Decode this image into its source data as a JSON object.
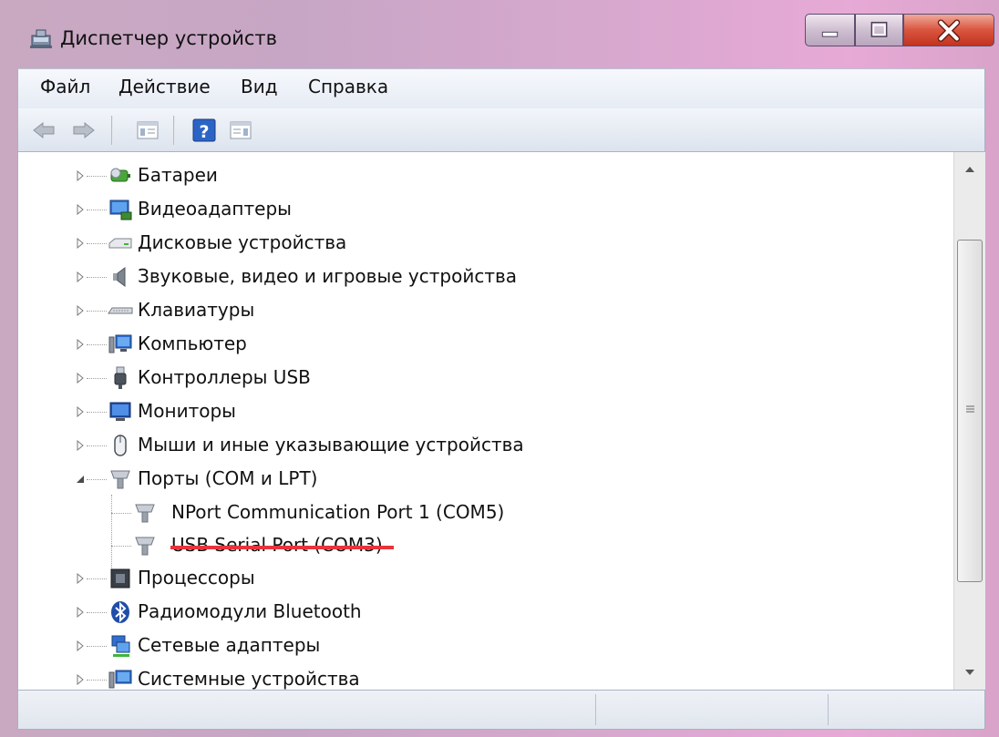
{
  "window": {
    "title": "Диспетчер устройств",
    "controls": {
      "minimize_icon": "minimize-icon",
      "maximize_icon": "maximize-icon",
      "close_icon": "close-icon"
    }
  },
  "menu": {
    "items": [
      "Файл",
      "Действие",
      "Вид",
      "Справка"
    ]
  },
  "toolbar": {
    "buttons": [
      "back-arrow-icon",
      "forward-arrow-icon",
      "properties-list-icon",
      "help-icon",
      "properties-panel-icon"
    ]
  },
  "tree": {
    "items": [
      {
        "label": "Батареи",
        "icon": "battery-icon",
        "expanded": false
      },
      {
        "label": "Видеоадаптеры",
        "icon": "display-adapter-icon",
        "expanded": false
      },
      {
        "label": "Дисковые устройства",
        "icon": "disk-drive-icon",
        "expanded": false
      },
      {
        "label": "Звуковые, видео и игровые устройства",
        "icon": "speaker-icon",
        "expanded": false
      },
      {
        "label": "Клавиатуры",
        "icon": "keyboard-icon",
        "expanded": false
      },
      {
        "label": "Компьютер",
        "icon": "computer-icon",
        "expanded": false
      },
      {
        "label": "Контроллеры USB",
        "icon": "usb-connector-icon",
        "expanded": false
      },
      {
        "label": "Мониторы",
        "icon": "monitor-icon",
        "expanded": false
      },
      {
        "label": "Мыши и иные указывающие устройства",
        "icon": "mouse-icon",
        "expanded": false
      },
      {
        "label": "Порты (COM и LPT)",
        "icon": "port-connector-icon",
        "expanded": true,
        "children": [
          {
            "label": "NPort Communication Port 1 (COM5)",
            "icon": "port-connector-icon"
          },
          {
            "label": "USB Serial Port (COM3)",
            "icon": "port-connector-icon",
            "highlighted": true
          }
        ]
      },
      {
        "label": "Процессоры",
        "icon": "processor-icon",
        "expanded": false
      },
      {
        "label": "Радиомодули Bluetooth",
        "icon": "bluetooth-icon",
        "expanded": false
      },
      {
        "label": "Сетевые адаптеры",
        "icon": "network-adapter-icon",
        "expanded": false
      },
      {
        "label": "Системные устройства",
        "icon": "system-devices-icon",
        "expanded": false
      }
    ]
  },
  "colors": {
    "highlight_underline": "#e8343a",
    "title_gradient_end": "#e7a9d6",
    "close_button": "#d9553f"
  }
}
